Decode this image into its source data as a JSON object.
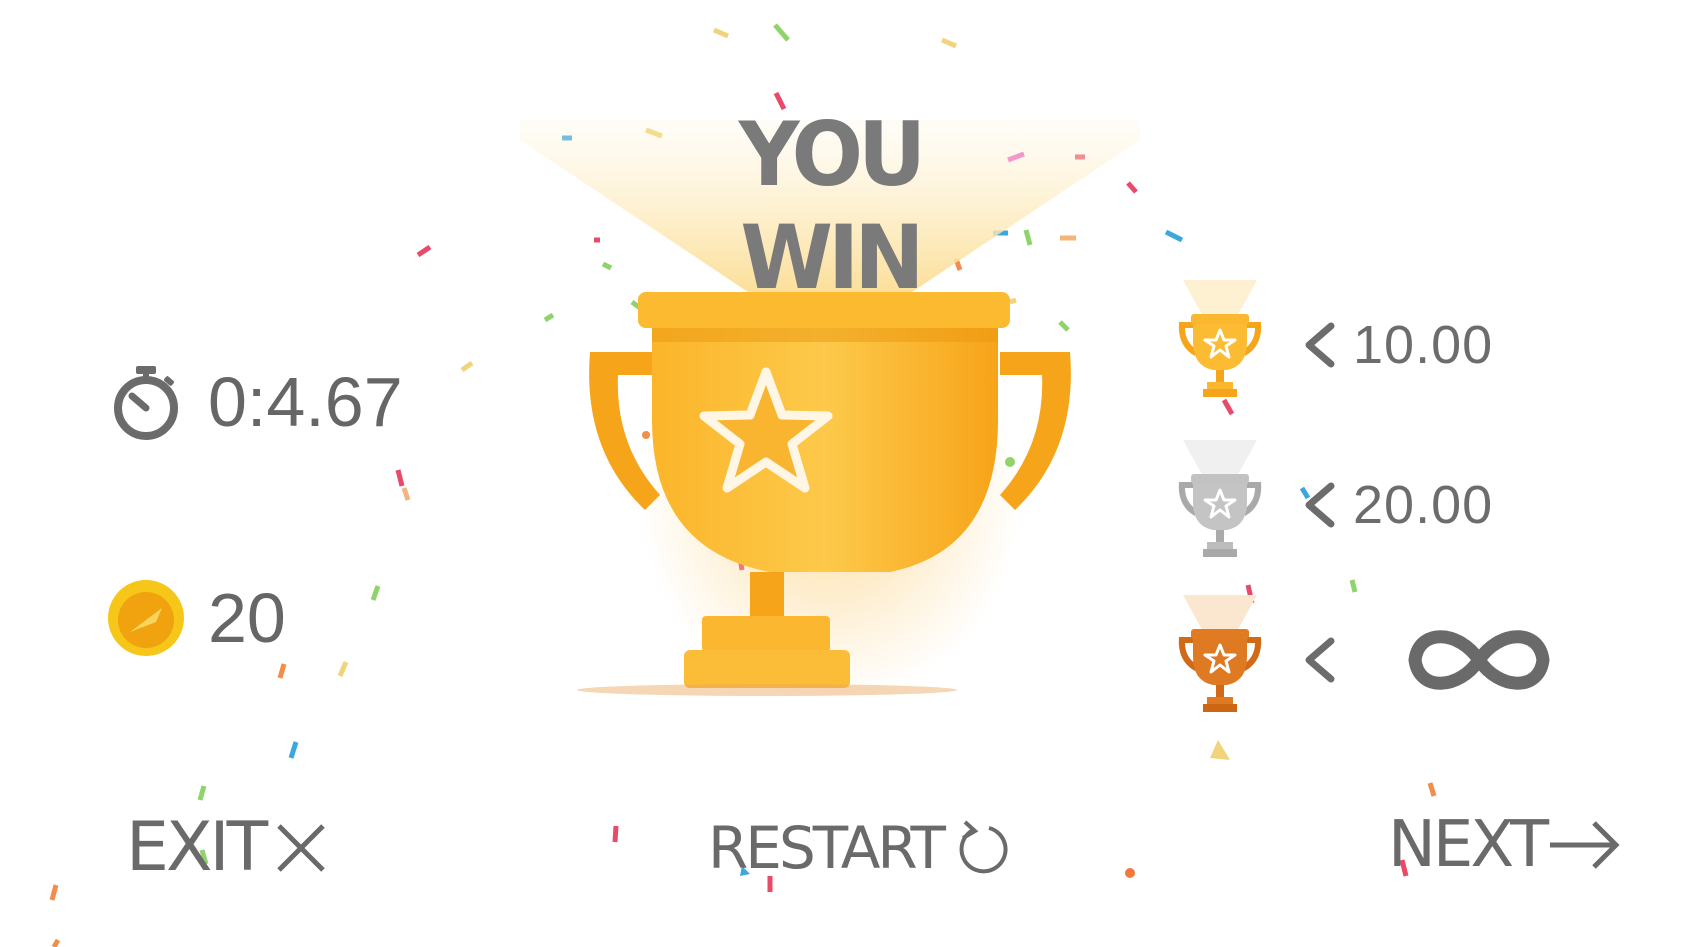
{
  "title": "YOU WIN",
  "stats": {
    "time": "0:4.67",
    "time_icon": "stopwatch-icon",
    "coins": "20",
    "coin_icon": "coin-icon"
  },
  "ranks": [
    {
      "medal": "gold",
      "comparator": "<",
      "value": "10.00"
    },
    {
      "medal": "silver",
      "comparator": "<",
      "value": "20.00"
    },
    {
      "medal": "bronze",
      "comparator": "<",
      "value": "∞"
    }
  ],
  "buttons": {
    "exit": "EXIT",
    "restart": "RESTART",
    "next": "NEXT"
  },
  "colors": {
    "text": "#6a6a6a",
    "gold": "#f7a81b",
    "silver": "#b9b9b9",
    "bronze": "#d8731c"
  }
}
